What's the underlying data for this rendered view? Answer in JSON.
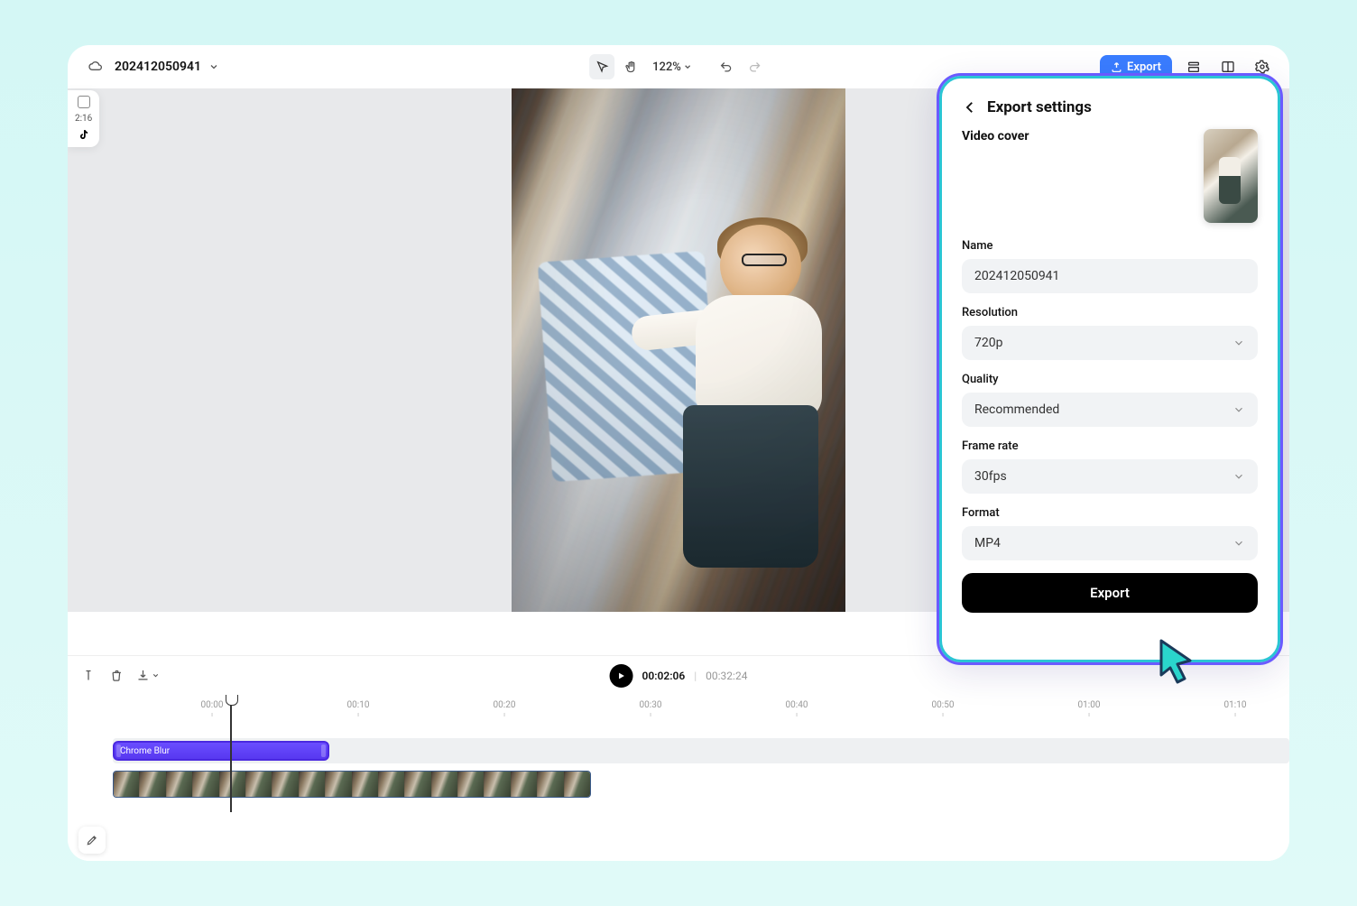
{
  "toolbar": {
    "project_name": "202412050941",
    "zoom": "122%",
    "export_label": "Export"
  },
  "side": {
    "duration": "2:16"
  },
  "playbar": {
    "current": "00:02:06",
    "total": "00:32:24"
  },
  "ruler": {
    "marks": [
      "00:00",
      "00:10",
      "00:20",
      "00:30",
      "00:40",
      "00:50",
      "01:00",
      "01:10"
    ]
  },
  "tracks": {
    "effect_name": "Chrome Blur"
  },
  "export": {
    "title": "Export settings",
    "cover_label": "Video cover",
    "fields": {
      "name": {
        "label": "Name",
        "value": "202412050941"
      },
      "resolution": {
        "label": "Resolution",
        "value": "720p"
      },
      "quality": {
        "label": "Quality",
        "value": "Recommended"
      },
      "framerate": {
        "label": "Frame rate",
        "value": "30fps"
      },
      "format": {
        "label": "Format",
        "value": "MP4"
      }
    },
    "action": "Export"
  }
}
